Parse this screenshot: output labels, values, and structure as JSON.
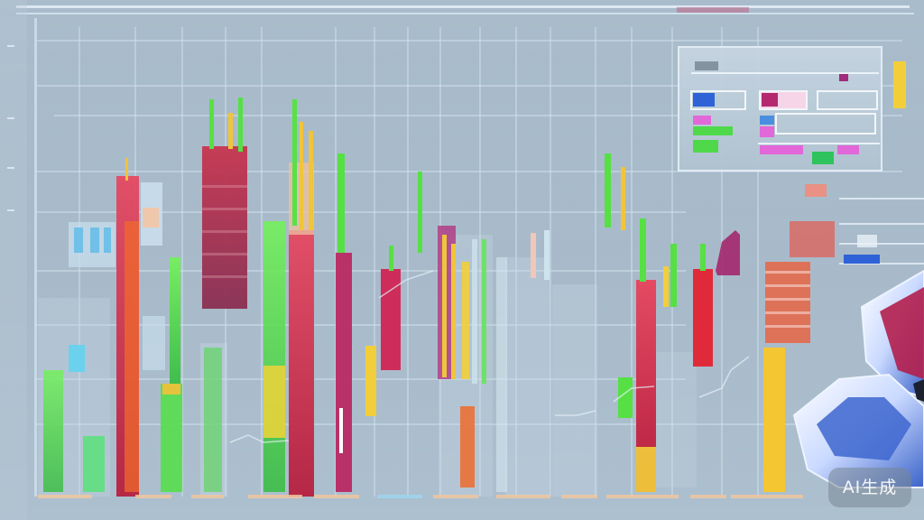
{
  "watermark": {
    "text": "AI生成"
  },
  "colors": {
    "background": "#a3b7c7",
    "grid": "#d7e5f0",
    "red": "#d83a55",
    "crimson": "#c2244b",
    "green": "#4fd94a",
    "yellow": "#f2cf3a",
    "orange": "#ef6a2c",
    "magenta": "#b3286e",
    "cyan": "#7fdcef",
    "blue": "#2f62d6"
  }
}
